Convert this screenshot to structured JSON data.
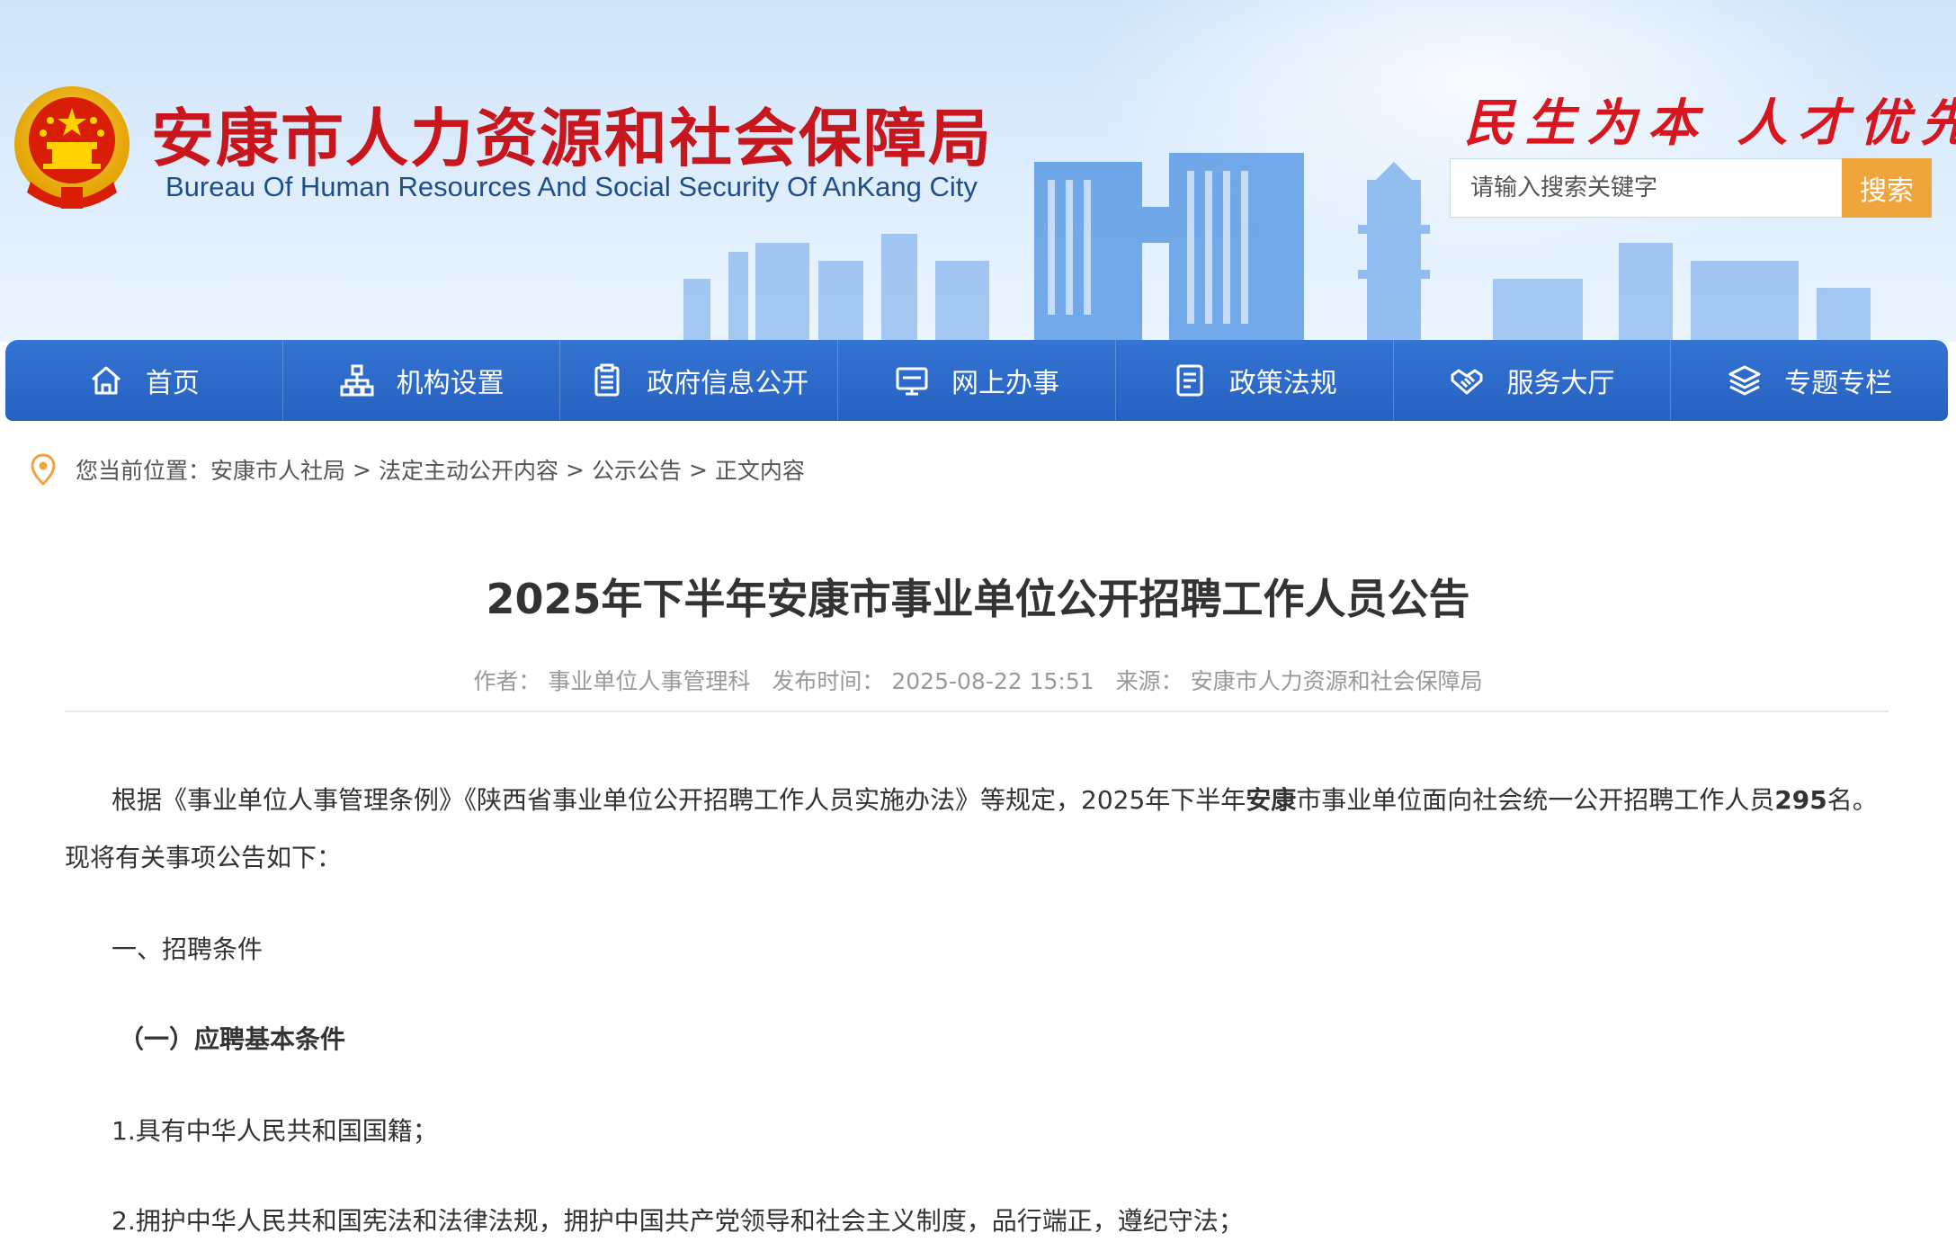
{
  "header": {
    "title_cn": "安康市人力资源和社会保障局",
    "title_en": "Bureau Of Human Resources And Social Security Of AnKang City",
    "slogan": "民生为本 人才优先",
    "search": {
      "placeholder": "请输入搜索关键字",
      "button_label": "搜索"
    }
  },
  "nav": {
    "items": [
      {
        "label": "首页",
        "icon": "home-icon"
      },
      {
        "label": "机构设置",
        "icon": "org-chart-icon"
      },
      {
        "label": "政府信息公开",
        "icon": "clipboard-icon"
      },
      {
        "label": "网上办事",
        "icon": "monitor-icon"
      },
      {
        "label": "政策法规",
        "icon": "document-icon"
      },
      {
        "label": "服务大厅",
        "icon": "handshake-icon"
      },
      {
        "label": "专题专栏",
        "icon": "layers-icon"
      }
    ]
  },
  "breadcrumb": {
    "prefix": "您当前位置：",
    "items": [
      "安康市人社局",
      "法定主动公开内容",
      "公示公告",
      "正文内容"
    ],
    "separator": ">"
  },
  "article": {
    "title": "2025年下半年安康市事业单位公开招聘工作人员公告",
    "meta": {
      "author_label": "作者：",
      "author": "事业单位人事管理科",
      "date_label": "发布时间：",
      "date": "2025-08-22 15:51",
      "source_label": "来源：",
      "source": "安康市人力资源和社会保障局"
    },
    "intro": {
      "part1": "根据《事业单位人事管理条例》《陕西省事业单位公开招聘工作人员实施办法》等规定，2025年下半年",
      "bold1": "安康",
      "part2": "市事业单位面向社会统一公开招聘工作人员",
      "bold2": "295",
      "part3": "名。现将有关事项公告如下："
    },
    "section1": "一、招聘条件",
    "subsection1": "（一）应聘基本条件",
    "item1": "1.具有中华人民共和国国籍；",
    "item2": "2.拥护中华人民共和国宪法和法律法规，拥护中国共产党领导和社会主义制度，品行端正，遵纪守法；"
  },
  "colors": {
    "nav_bg": "#2a66c8",
    "title_red": "#c8161d",
    "search_button": "#f0a43c",
    "breadcrumb_pin": "#f0a43c"
  }
}
